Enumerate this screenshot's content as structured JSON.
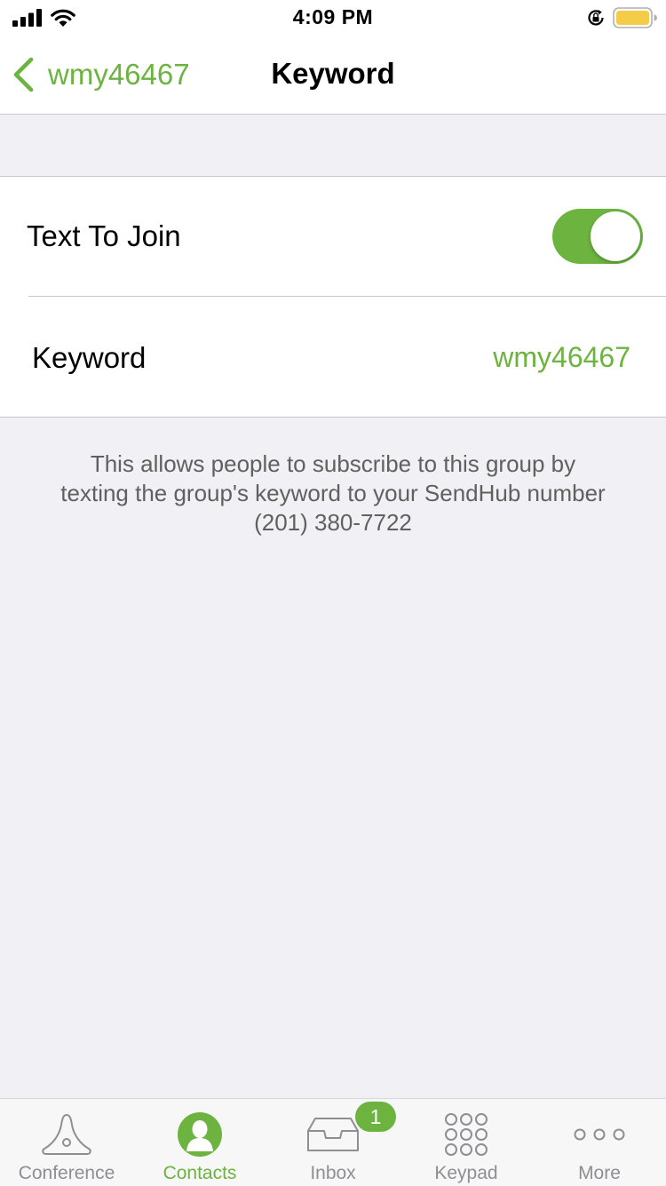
{
  "status_bar": {
    "time": "4:09 PM",
    "icons": [
      "signal-icon",
      "wifi-icon",
      "orientation-lock-icon",
      "battery-icon"
    ],
    "battery_color": "#f5cc47"
  },
  "nav": {
    "back_label": "wmy46467",
    "title": "Keyword"
  },
  "settings": {
    "text_to_join": {
      "label": "Text To Join",
      "enabled": true
    },
    "keyword": {
      "label": "Keyword",
      "value": "wmy46467"
    }
  },
  "footer_note": {
    "lines": [
      "This allows people to subscribe to this group by",
      "texting the group's keyword to your SendHub number",
      "(201) 380-7722"
    ]
  },
  "tab_bar": {
    "tabs": [
      {
        "label": "Conference",
        "icon": "conference-icon",
        "active": false
      },
      {
        "label": "Contacts",
        "icon": "contacts-icon",
        "active": true
      },
      {
        "label": "Inbox",
        "icon": "inbox-icon",
        "active": false,
        "badge": "1"
      },
      {
        "label": "Keypad",
        "icon": "keypad-icon",
        "active": false
      },
      {
        "label": "More",
        "icon": "more-icon",
        "active": false
      }
    ]
  },
  "colors": {
    "accent": "#6cb33f",
    "background": "#f1f1f5",
    "inactive_tab": "#8e8e93"
  }
}
